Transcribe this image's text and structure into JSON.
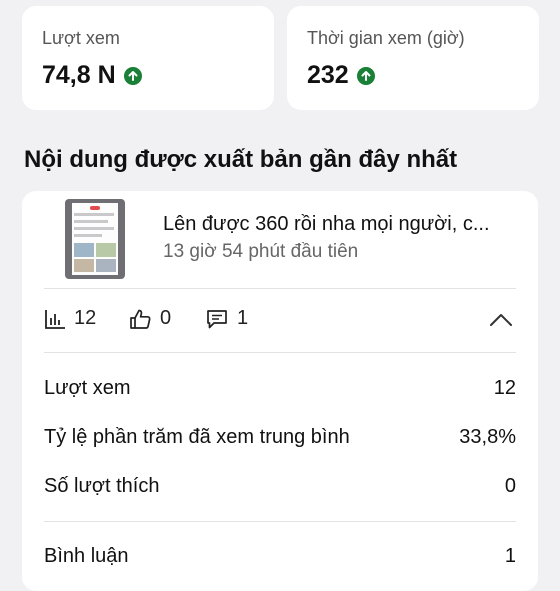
{
  "stats": {
    "views": {
      "label": "Lượt xem",
      "value": "74,8 N",
      "trend_icon": "arrow-up-circle-icon"
    },
    "watch_time": {
      "label": "Thời gian xem (giờ)",
      "value": "232",
      "trend_icon": "arrow-up-circle-icon"
    }
  },
  "section": {
    "title": "Nội dung được xuất bản gần đây nhất"
  },
  "post": {
    "title": "Lên được 360 rồi nha mọi người, c...",
    "subtitle": "13 giờ 54 phút đầu tiên",
    "metrics": {
      "views": "12",
      "likes": "0",
      "comments": "1"
    }
  },
  "details": [
    {
      "label": "Lượt xem",
      "value": "12"
    },
    {
      "label": "Tỷ lệ phần trăm đã xem trung bình",
      "value": "33,8%"
    },
    {
      "label": "Số lượt thích",
      "value": "0"
    },
    {
      "label": "Bình luận",
      "value": "1"
    }
  ],
  "colors": {
    "trend_up": "#1a7f37",
    "card_bg": "#ffffff",
    "page_bg": "#f1f1f3"
  }
}
